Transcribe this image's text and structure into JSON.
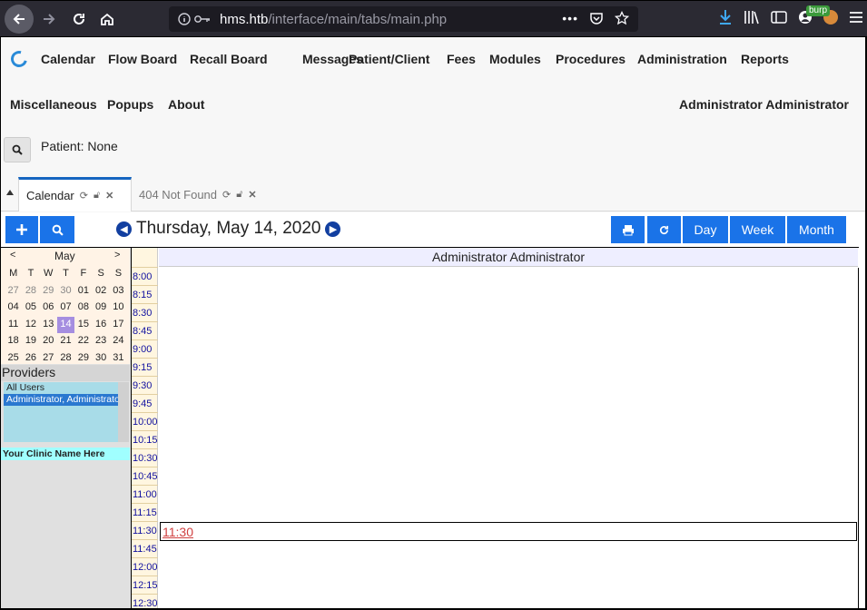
{
  "browser": {
    "url_host": "hms.htb",
    "url_path": "/interface/main/tabs/main.php",
    "burp_badge": "burp"
  },
  "menu": {
    "row1": [
      "Calendar",
      "Flow Board",
      "Recall Board",
      "Messages",
      "Patient/Client",
      "Fees",
      "Modules",
      "Procedures",
      "Administration",
      "Reports"
    ],
    "row2": [
      "Miscellaneous",
      "Popups",
      "About"
    ],
    "user": "Administrator Administrator"
  },
  "patient": {
    "label": "Patient: None"
  },
  "tabs": [
    {
      "label": "Calendar",
      "active": true
    },
    {
      "label": "404 Not Found",
      "active": false
    }
  ],
  "toolbar": {
    "date": "Thursday, May 14, 2020",
    "day_label": "Day",
    "week_label": "Week",
    "month_label": "Month"
  },
  "minical": {
    "month": "May",
    "prev": "<",
    "next": ">",
    "weekdays": [
      "M",
      "T",
      "W",
      "T",
      "F",
      "S",
      "S"
    ],
    "days": [
      [
        "27",
        "28",
        "29",
        "30",
        "01",
        "02",
        "03"
      ],
      [
        "04",
        "05",
        "06",
        "07",
        "08",
        "09",
        "10"
      ],
      [
        "11",
        "12",
        "13",
        "14",
        "15",
        "16",
        "17"
      ],
      [
        "18",
        "19",
        "20",
        "21",
        "22",
        "23",
        "24"
      ],
      [
        "25",
        "26",
        "27",
        "28",
        "29",
        "30",
        "31"
      ]
    ],
    "muted_days": [
      "27",
      "28",
      "29",
      "30"
    ],
    "today": "14"
  },
  "providers": {
    "heading": "Providers",
    "options": [
      "All Users",
      "Administrator, Administrator"
    ],
    "selected": "Administrator, Administrator",
    "clinic": "Your Clinic Name Here"
  },
  "dayview": {
    "provider": "Administrator Administrator",
    "times": [
      "8:00",
      "8:15",
      "8:30",
      "8:45",
      "9:00",
      "9:15",
      "9:30",
      "9:45",
      "10:00",
      "10:15",
      "10:30",
      "10:45",
      "11:00",
      "11:15",
      "11:30",
      "11:45",
      "12:00",
      "12:15",
      "12:30"
    ],
    "event_time": "11:30"
  },
  "colors": {
    "accent": "#1a73e8",
    "today": "#a58ee0",
    "clinic_bg": "#a0ffff",
    "provider_list_bg": "#a8dce8"
  }
}
